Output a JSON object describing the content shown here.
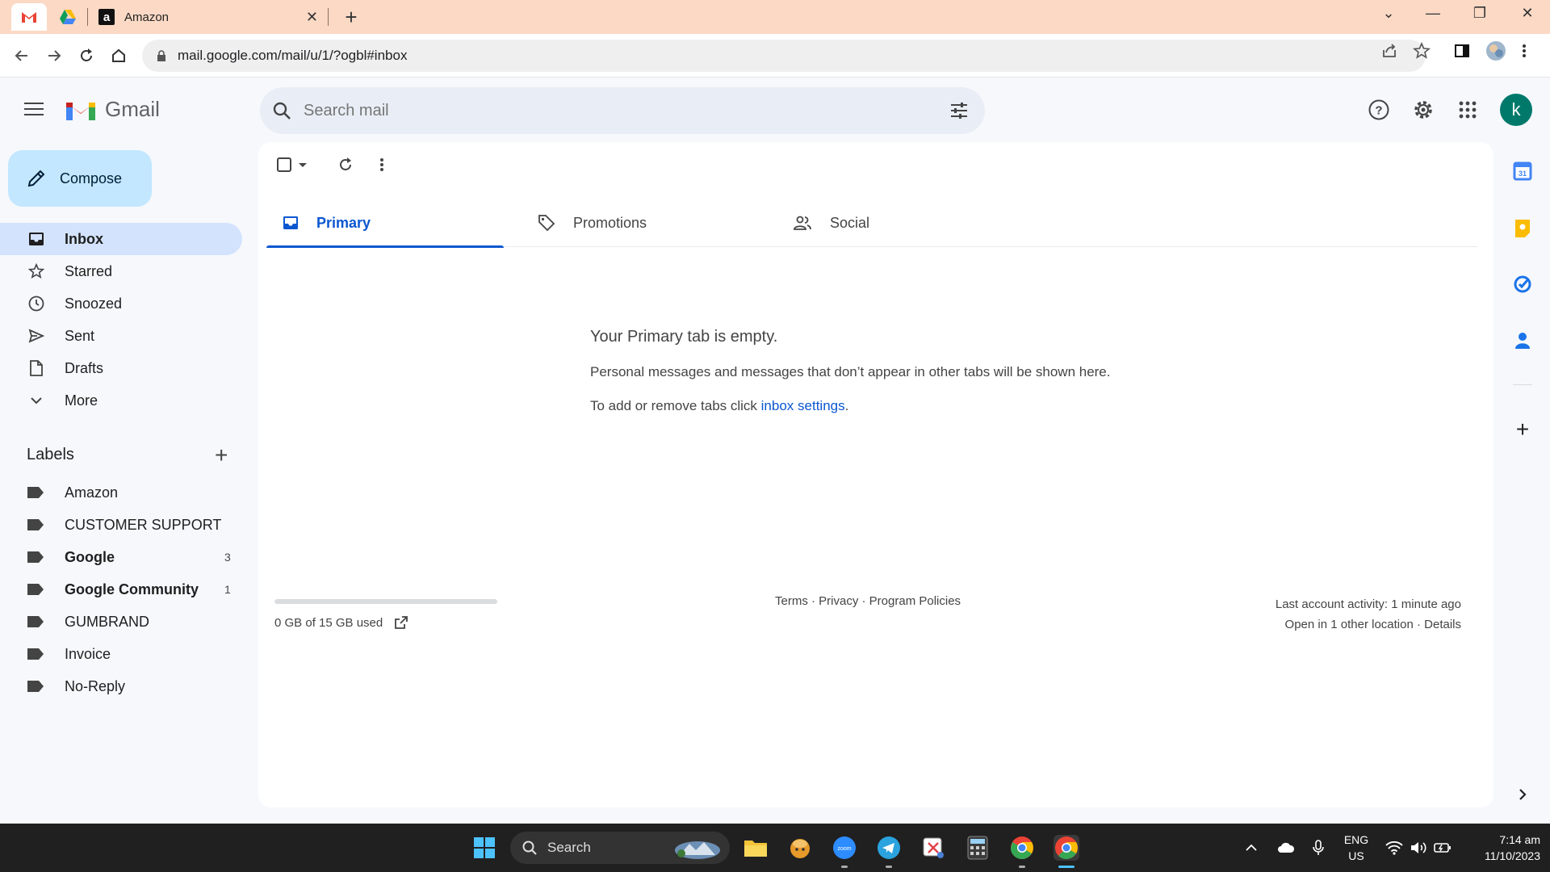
{
  "browser": {
    "active_tab_title": "Amazon",
    "url": "mail.google.com/mail/u/1/?ogbl#inbox"
  },
  "gmail": {
    "logo_text": "Gmail",
    "search_placeholder": "Search mail",
    "avatar_letter": "k",
    "compose_label": "Compose",
    "nav": [
      {
        "label": "Inbox"
      },
      {
        "label": "Starred"
      },
      {
        "label": "Snoozed"
      },
      {
        "label": "Sent"
      },
      {
        "label": "Drafts"
      },
      {
        "label": "More"
      }
    ],
    "labels_heading": "Labels",
    "labels": [
      {
        "label": "Amazon",
        "count": ""
      },
      {
        "label": "CUSTOMER SUPPORT",
        "count": ""
      },
      {
        "label": "Google",
        "count": "3"
      },
      {
        "label": "Google Community",
        "count": "1"
      },
      {
        "label": "GUMBRAND",
        "count": ""
      },
      {
        "label": "Invoice",
        "count": ""
      },
      {
        "label": "No-Reply",
        "count": ""
      }
    ],
    "tabs": [
      {
        "label": "Primary"
      },
      {
        "label": "Promotions"
      },
      {
        "label": "Social"
      }
    ],
    "empty_title": "Your Primary tab is empty.",
    "empty_desc": "Personal messages and messages that don’t appear in other tabs will be shown here.",
    "empty_hint_prefix": "To add or remove tabs click ",
    "empty_hint_link": "inbox settings",
    "empty_hint_suffix": ".",
    "storage_text": "0 GB of 15 GB used",
    "storage_used_fraction": 0,
    "footer_links": "Terms · Privacy · Program Policies",
    "activity_line1": "Last account activity: 1 minute ago",
    "activity_line2": "Open in 1 other location · Details"
  },
  "taskbar": {
    "search_label": "Search",
    "lang_line1": "ENG",
    "lang_line2": "US",
    "time": "7:14 am",
    "date": "11/10/2023"
  },
  "colors": {
    "accent": "#0b57d0",
    "compose_bg": "#c2e7ff",
    "active_nav_bg": "#d3e3fd",
    "tabstrip_bg": "#fbd9c5"
  }
}
